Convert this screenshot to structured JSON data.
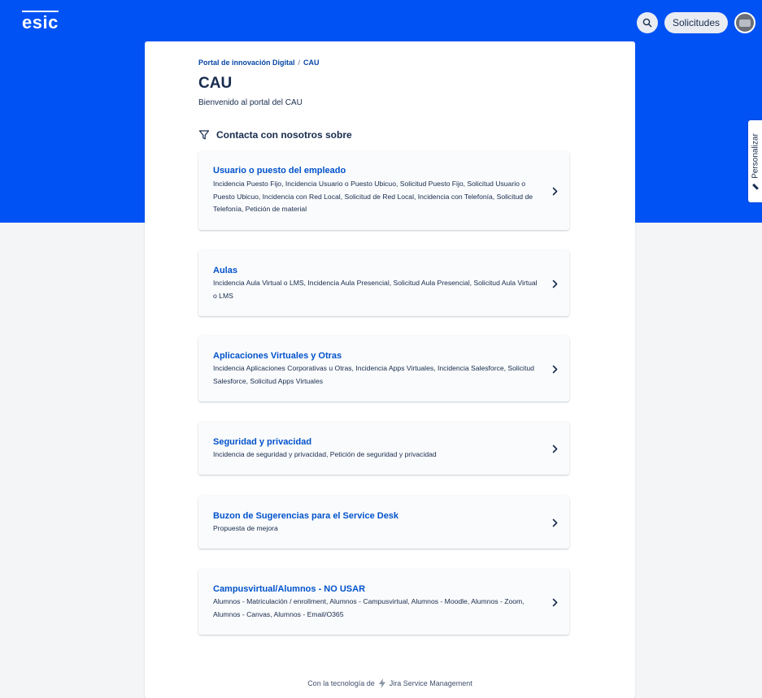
{
  "header": {
    "logo": "esic",
    "search_icon": "search-icon",
    "requests_label": "Solicitudes",
    "brand_color": "#0052f5"
  },
  "personalize_label": "Personalizar",
  "breadcrumb": {
    "portal": "Portal de innovación Digital",
    "separator": "/",
    "current": "CAU"
  },
  "page": {
    "title": "CAU",
    "subtitle": "Bienvenido al portal del CAU",
    "section_heading": "Contacta con nosotros sobre"
  },
  "categories": [
    {
      "title": "Usuario o puesto del empleado",
      "description": "Incidencia Puesto Fijo, Incidencia Usuario o Puesto Ubicuo, Solicitud Puesto Fijo, Solicitud Usuario o Puesto Ubicuo, Incidencia con Red Local, Solicitud de Red Local, Incidencia con Telefonía, Solicitud de Telefonía, Petición de material"
    },
    {
      "title": "Aulas",
      "description": "Incidencia Aula Virtual o LMS, Incidencia Aula Presencial, Solicitud Aula Presencial, Solicitud Aula Virtual o LMS"
    },
    {
      "title": "Aplicaciones Virtuales y Otras",
      "description": "Incidencia Aplicaciones Corporativas u Otras, Incidencia Apps Virtuales, Incidencia Salesforce, Solicitud Salesforce, Solicitud Apps Virtuales"
    },
    {
      "title": "Seguridad y privacidad",
      "description": "Incidencia de seguridad y privacidad, Petición de seguridad y privacidad"
    },
    {
      "title": "Buzon de Sugerencias para el Service Desk",
      "description": "Propuesta de mejora"
    },
    {
      "title": "Campusvirtual/Alumnos - NO USAR",
      "description": "Alumnos - Matriculación / enrollment, Alumnos - Campusvirtual, Alumnos - Moodle, Alumnos - Zoom, Alumnos - Canvas, Alumnos - Email/O365"
    }
  ],
  "footer": {
    "prefix": "Con la tecnología de",
    "product": "Jira Service Management"
  }
}
